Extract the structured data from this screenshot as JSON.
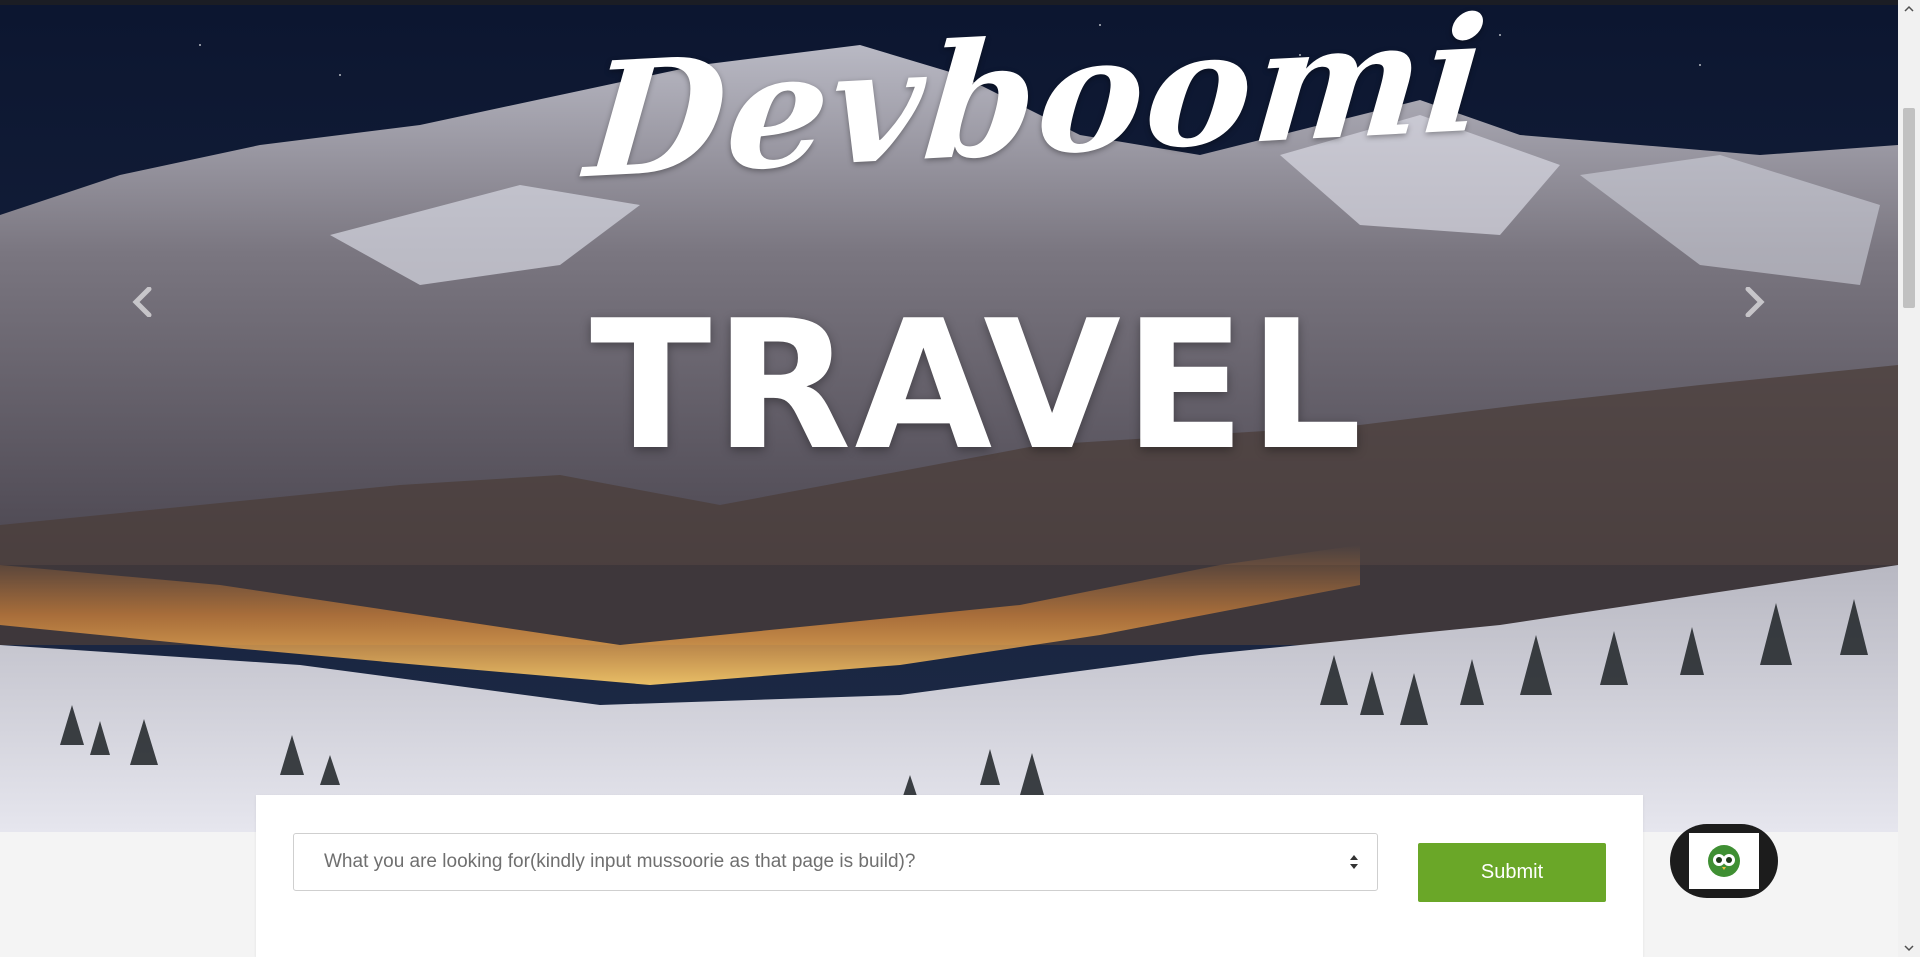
{
  "hero": {
    "script_logo": "Devboomi",
    "title": "TRAVEL",
    "prev_icon": "chevron-left-icon",
    "next_icon": "chevron-right-icon"
  },
  "search": {
    "placeholder": "What you are looking for(kindly input mussoorie as that page is build)?",
    "caret_icon": "select-caret-icon",
    "submit_label": "Submit"
  },
  "chat_widget": {
    "icon": "owl-bot-icon"
  },
  "colors": {
    "submit_green": "#6aa728",
    "chat_dark": "#1c1c1c",
    "owl_green": "#4a9a3a"
  }
}
